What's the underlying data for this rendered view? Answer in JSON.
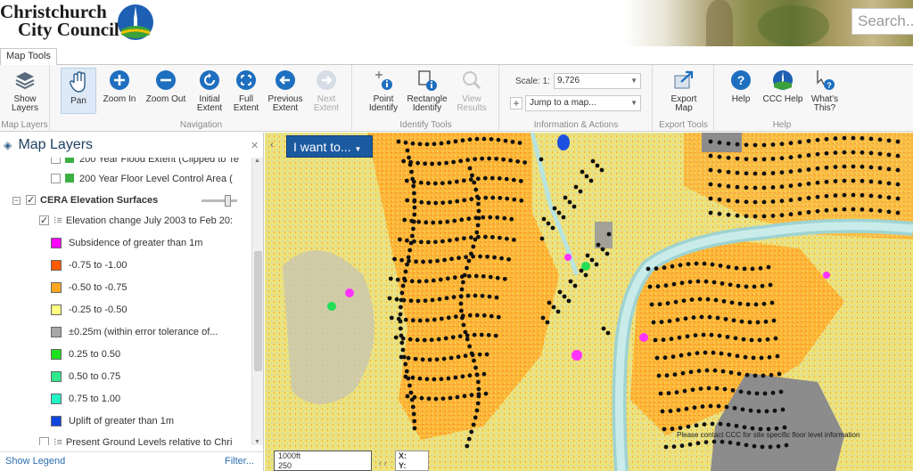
{
  "header": {
    "logo_line1": "Christchurch",
    "logo_line2": "City Council",
    "search_placeholder": "Search..."
  },
  "ribbon": {
    "tab_label": "Map Tools",
    "groups": {
      "map_layers": "Map Layers",
      "navigation": "Navigation",
      "identify_tools": "Identify Tools",
      "information_actions": "Information & Actions",
      "export_tools": "Export Tools",
      "help": "Help"
    },
    "buttons": {
      "show_layers": [
        "Show",
        "Layers"
      ],
      "pan": "Pan",
      "zoom_in": "Zoom In",
      "zoom_out": "Zoom Out",
      "initial_extent": [
        "Initial",
        "Extent"
      ],
      "full_extent": [
        "Full",
        "Extent"
      ],
      "previous_extent": [
        "Previous",
        "Extent"
      ],
      "next_extent": [
        "Next",
        "Extent"
      ],
      "point_identify": [
        "Point",
        "Identify"
      ],
      "rectangle_identify": [
        "Rectangle",
        "Identify"
      ],
      "view_results": [
        "View",
        "Results"
      ],
      "export_map": [
        "Export",
        "Map"
      ],
      "help": "Help",
      "ccc_help": "CCC Help",
      "whats_this": [
        "What's",
        "This?"
      ]
    },
    "scale_label": "Scale: 1:",
    "scale_value": "9,726",
    "jump_to": "Jump to a map..."
  },
  "panel": {
    "title": "Map Layers",
    "rows": {
      "partial_top": "200 Year Flood Extent (Clipped to Te",
      "floor_level": "200 Year Floor Level Control Area (",
      "cera_group": "CERA Elevation Surfaces",
      "elevation_change": "Elevation change July 2003 to Feb 20:",
      "present_ground": "Present Ground Levels relative to Chri"
    },
    "legend": [
      {
        "label": "Subsidence of greater than 1m",
        "color": "#ff00ff"
      },
      {
        "label": "-0.75 to -1.00",
        "color": "#ff5a00"
      },
      {
        "label": "-0.50 to -0.75",
        "color": "#ffa51f"
      },
      {
        "label": "-0.25 to -0.50",
        "color": "#ffff80"
      },
      {
        "label": "±0.25m (within error tolerance of...",
        "color": "#a8a8a8"
      },
      {
        "label": "0.25 to 0.50",
        "color": "#1fe01f"
      },
      {
        "label": "0.50 to 0.75",
        "color": "#2ee88a"
      },
      {
        "label": "0.75 to 1.00",
        "color": "#22f2c6"
      },
      {
        "label": "Uplift of greater than 1m",
        "color": "#1046e0"
      }
    ],
    "show_legend": "Show Legend",
    "filter": "Filter..."
  },
  "map": {
    "i_want_to": "I want to...",
    "note": "Please contact CCC for site specific floor level information",
    "scalebar_top": "1000ft",
    "scalebar_bottom": "250",
    "coord_x": "X:",
    "coord_y": "Y:"
  }
}
